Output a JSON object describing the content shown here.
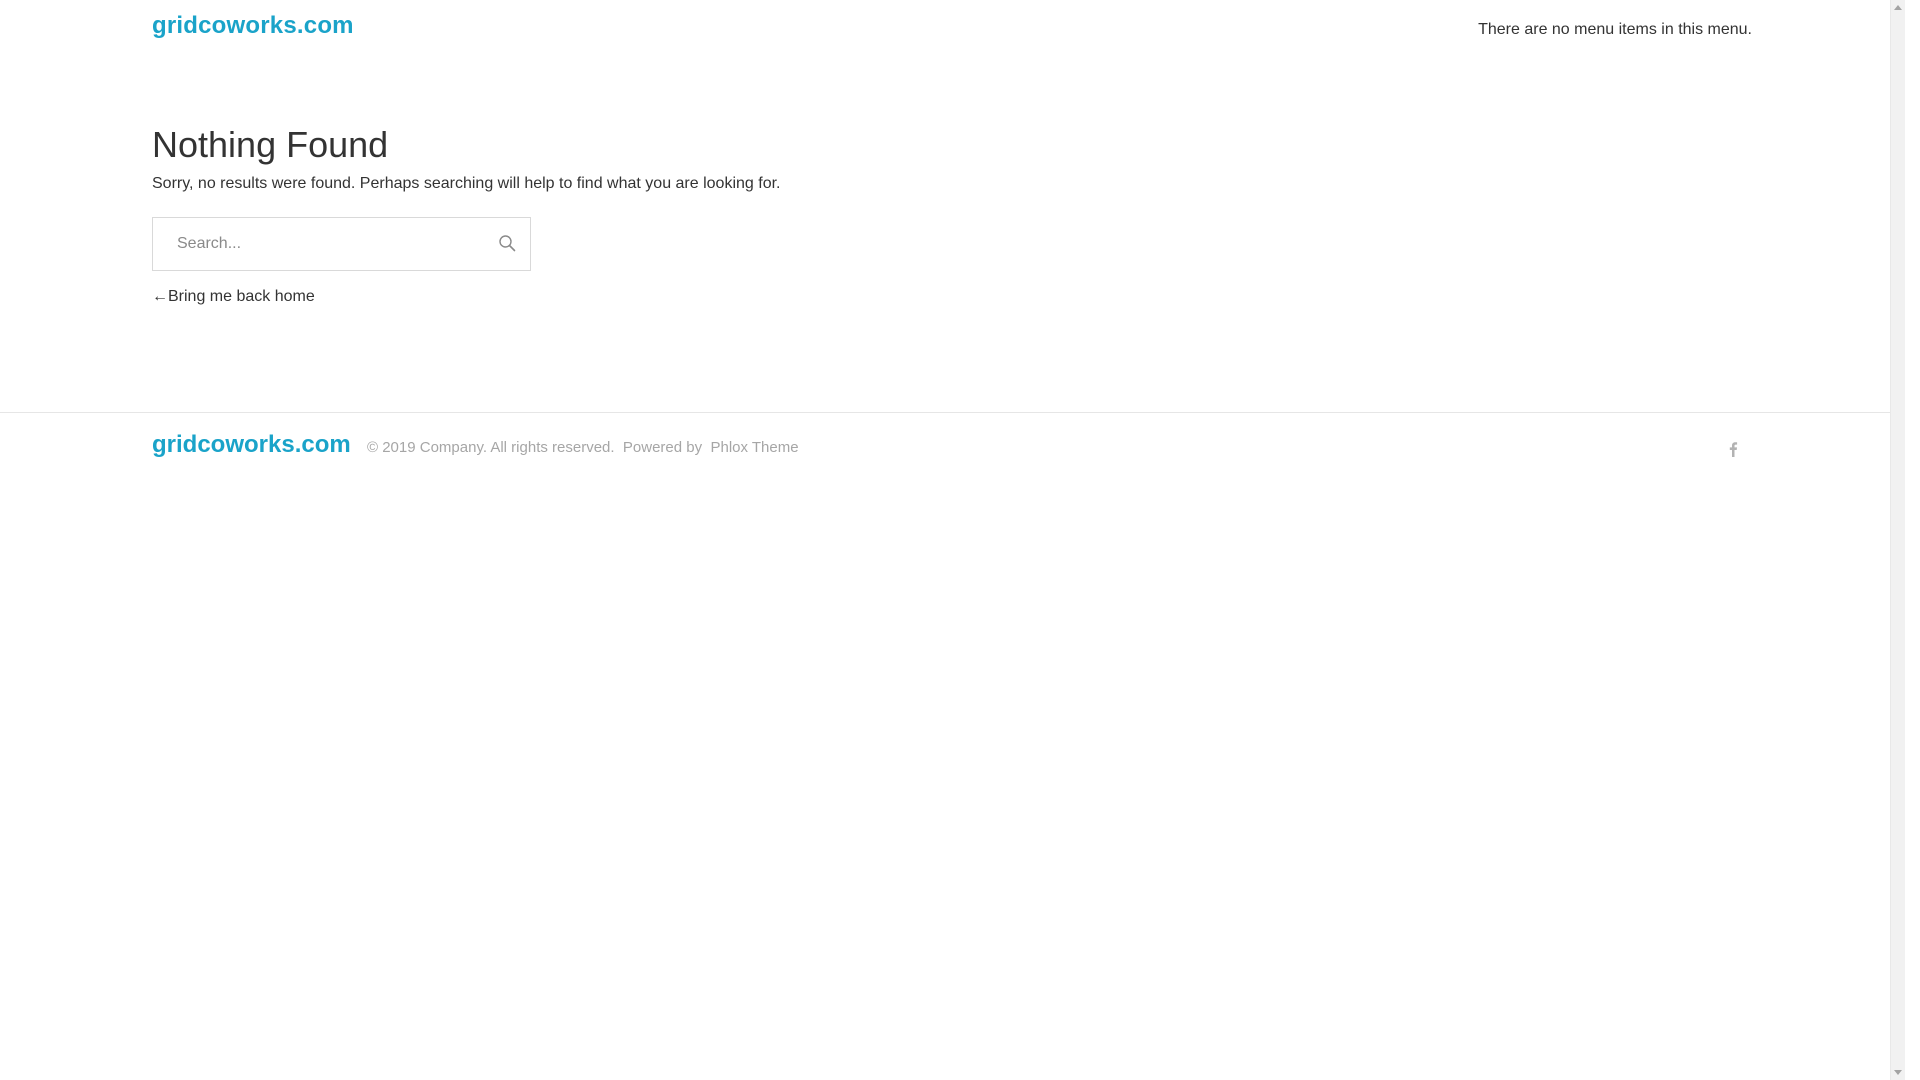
{
  "header": {
    "logo_text": "gridcoworks.com",
    "menu_note": "There are no menu items in this menu."
  },
  "main": {
    "title": "Nothing Found",
    "message": "Sorry, no results were found. Perhaps searching will help to find what you are looking for.",
    "search": {
      "placeholder": "Search...",
      "button_icon": "search-icon"
    },
    "back_link": "←Bring me back home"
  },
  "footer": {
    "logo_text": "gridcoworks.com",
    "copyright": "© 2019 Company. All rights reserved.",
    "powered_by": "Powered by",
    "theme_name": "Phlox Theme",
    "social": [
      {
        "icon": "facebook-icon"
      }
    ]
  },
  "colors": {
    "brand": "#1aa3c9",
    "text": "#333333",
    "muted": "#a6a6a6",
    "border": "#d9d9d9"
  }
}
